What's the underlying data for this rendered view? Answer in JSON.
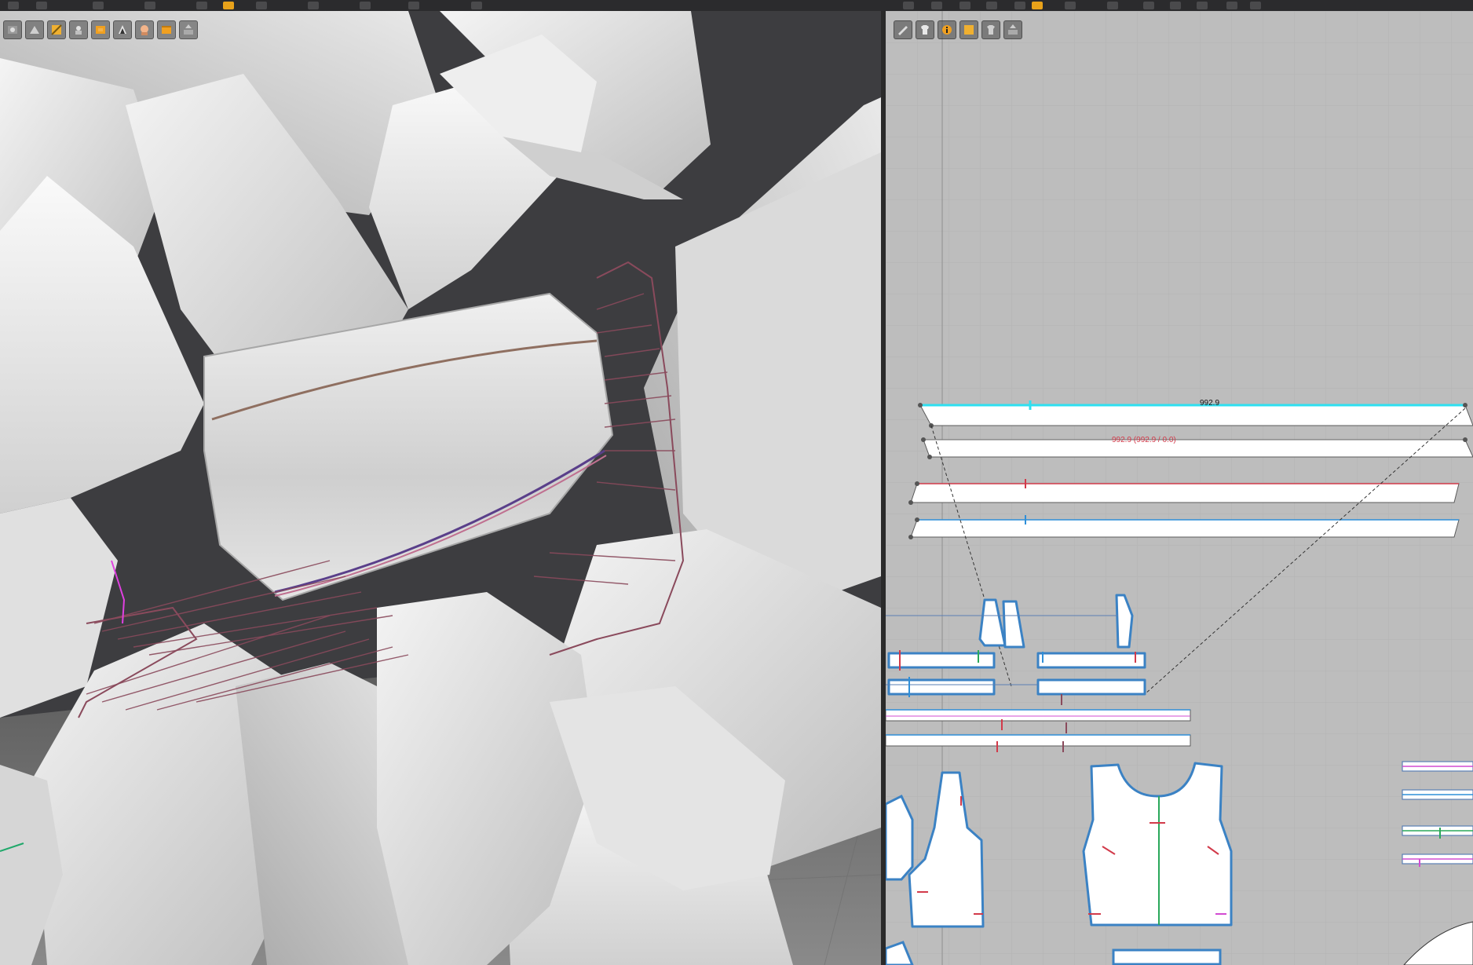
{
  "window": {
    "top_toolbar_icons": [
      "select-icon",
      "move-icon",
      "rotate-icon",
      "scale-icon",
      "sew-icon",
      "fold-icon",
      "pin-icon",
      "brush-icon",
      "simulate-icon",
      "render-icon",
      "grid-icon",
      "pattern-icon",
      "edit-icon",
      "segment-icon",
      "point-icon",
      "curve-icon",
      "trace-icon",
      "arrange-icon",
      "gizmo-icon",
      "eye-icon",
      "ruler-icon",
      "text-icon",
      "export-icon",
      "avatar-icon"
    ]
  },
  "viewport3d": {
    "toolbar_icons": [
      "avatar-display-icon",
      "fabric-display-icon",
      "texture-icon",
      "skin-icon",
      "garment-icon",
      "silhouette-icon",
      "avatar-face-icon",
      "thickness-icon",
      "export-3d-icon"
    ]
  },
  "viewport2d": {
    "toolbar_icons": [
      "edit-pattern-icon",
      "shirt-icon",
      "info-icon",
      "texture-2d-icon",
      "pattern-select-icon",
      "export-2d-icon"
    ],
    "measure_top": "992.9",
    "measure_second": "992.9 (992.9 / 0.0)"
  },
  "colors": {
    "accent": "#e8a21a",
    "selected_edge": "#2ee0f0",
    "seam_red": "#d23a4a",
    "seam_blue": "#2f8fd8",
    "seam_green": "#2aa85a",
    "seam_magenta": "#d24bd2",
    "sewing_line": "#8a4a5c",
    "pattern_fill": "#ffffff",
    "grid_bg": "#bdbdbd"
  }
}
